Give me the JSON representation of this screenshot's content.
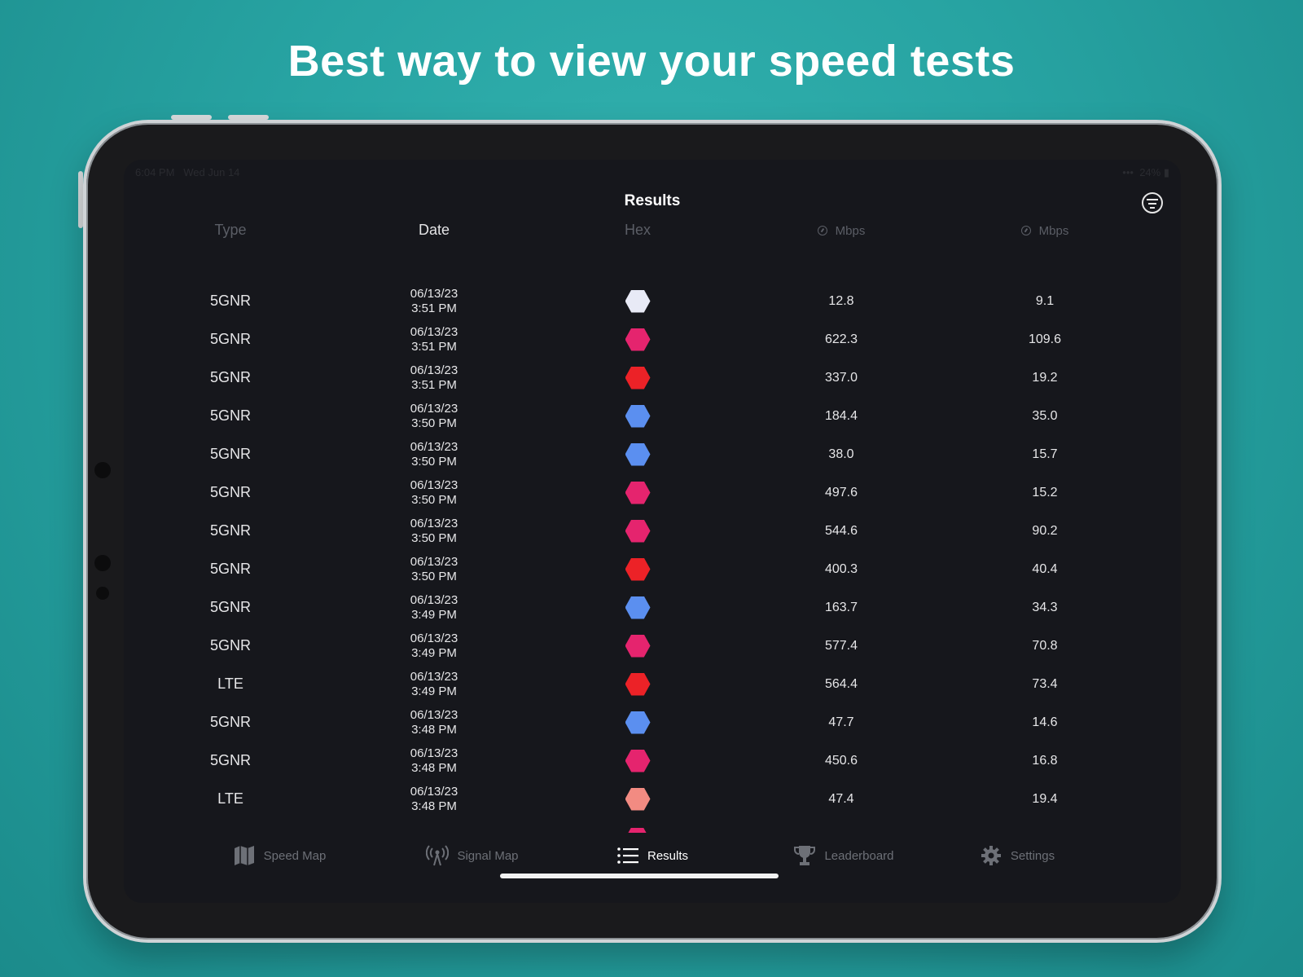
{
  "headline": "Best way to view your speed tests",
  "status_bar": {
    "time": "6:04 PM",
    "date": "Wed Jun 14",
    "battery": "24%"
  },
  "nav": {
    "title": "Results",
    "filter_icon": "filter-icon"
  },
  "columns": {
    "type": "Type",
    "date": "Date",
    "hex": "Hex",
    "download_unit": "Mbps",
    "upload_unit": "Mbps"
  },
  "hex_colors": {
    "white": "#e8eaf6",
    "pink": "#e5246e",
    "red": "#ec2227",
    "blue": "#5b8ff0",
    "salmon": "#f28b82"
  },
  "rows": [
    {
      "type": "5GNR",
      "date": "06/13/23",
      "time": "3:51 PM",
      "hex": "#e8eaf6",
      "download": "12.8",
      "upload": "9.1"
    },
    {
      "type": "5GNR",
      "date": "06/13/23",
      "time": "3:51 PM",
      "hex": "#e5246e",
      "download": "622.3",
      "upload": "109.6"
    },
    {
      "type": "5GNR",
      "date": "06/13/23",
      "time": "3:51 PM",
      "hex": "#ec2227",
      "download": "337.0",
      "upload": "19.2"
    },
    {
      "type": "5GNR",
      "date": "06/13/23",
      "time": "3:50 PM",
      "hex": "#5b8ff0",
      "download": "184.4",
      "upload": "35.0"
    },
    {
      "type": "5GNR",
      "date": "06/13/23",
      "time": "3:50 PM",
      "hex": "#5b8ff0",
      "download": "38.0",
      "upload": "15.7"
    },
    {
      "type": "5GNR",
      "date": "06/13/23",
      "time": "3:50 PM",
      "hex": "#e5246e",
      "download": "497.6",
      "upload": "15.2"
    },
    {
      "type": "5GNR",
      "date": "06/13/23",
      "time": "3:50 PM",
      "hex": "#e5246e",
      "download": "544.6",
      "upload": "90.2"
    },
    {
      "type": "5GNR",
      "date": "06/13/23",
      "time": "3:50 PM",
      "hex": "#ec2227",
      "download": "400.3",
      "upload": "40.4"
    },
    {
      "type": "5GNR",
      "date": "06/13/23",
      "time": "3:49 PM",
      "hex": "#5b8ff0",
      "download": "163.7",
      "upload": "34.3"
    },
    {
      "type": "5GNR",
      "date": "06/13/23",
      "time": "3:49 PM",
      "hex": "#e5246e",
      "download": "577.4",
      "upload": "70.8"
    },
    {
      "type": "LTE",
      "date": "06/13/23",
      "time": "3:49 PM",
      "hex": "#ec2227",
      "download": "564.4",
      "upload": "73.4"
    },
    {
      "type": "5GNR",
      "date": "06/13/23",
      "time": "3:48 PM",
      "hex": "#5b8ff0",
      "download": "47.7",
      "upload": "14.6"
    },
    {
      "type": "5GNR",
      "date": "06/13/23",
      "time": "3:48 PM",
      "hex": "#e5246e",
      "download": "450.6",
      "upload": "16.8"
    },
    {
      "type": "LTE",
      "date": "06/13/23",
      "time": "3:48 PM",
      "hex": "#f28b82",
      "download": "47.4",
      "upload": "19.4"
    }
  ],
  "tabs": [
    {
      "label": "Speed Map",
      "icon": "map-icon",
      "active": false
    },
    {
      "label": "Signal Map",
      "icon": "antenna-icon",
      "active": false
    },
    {
      "label": "Results",
      "icon": "list-icon",
      "active": true
    },
    {
      "label": "Leaderboard",
      "icon": "trophy-icon",
      "active": false
    },
    {
      "label": "Settings",
      "icon": "gear-icon",
      "active": false
    }
  ]
}
